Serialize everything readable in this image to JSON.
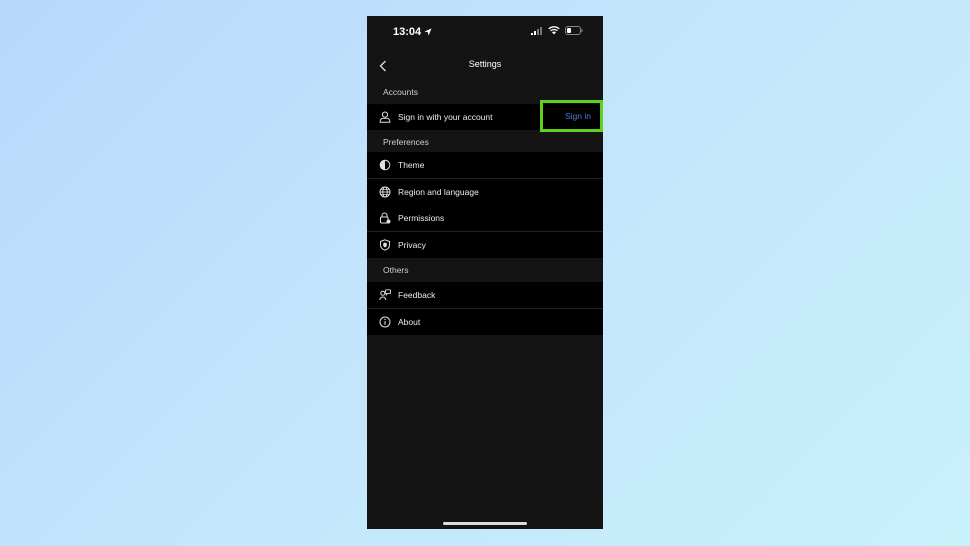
{
  "status_bar": {
    "time": "13:04"
  },
  "nav": {
    "title": "Settings"
  },
  "sections": {
    "accounts": {
      "header": "Accounts",
      "sign_in_row": {
        "label": "Sign in with your account",
        "action": "Sign in",
        "icon": "person-icon"
      }
    },
    "preferences": {
      "header": "Preferences",
      "items": [
        {
          "label": "Theme",
          "icon": "theme-icon"
        },
        {
          "label": "Region and language",
          "icon": "globe-icon"
        },
        {
          "label": "Permissions",
          "icon": "lock-icon"
        },
        {
          "label": "Privacy",
          "icon": "shield-icon"
        }
      ]
    },
    "others": {
      "header": "Others",
      "items": [
        {
          "label": "Feedback",
          "icon": "feedback-icon"
        },
        {
          "label": "About",
          "icon": "info-icon"
        }
      ]
    }
  },
  "colors": {
    "background": "#141414",
    "row_background": "#000000",
    "link": "#4a7fd8",
    "highlight": "#5ed11e"
  }
}
